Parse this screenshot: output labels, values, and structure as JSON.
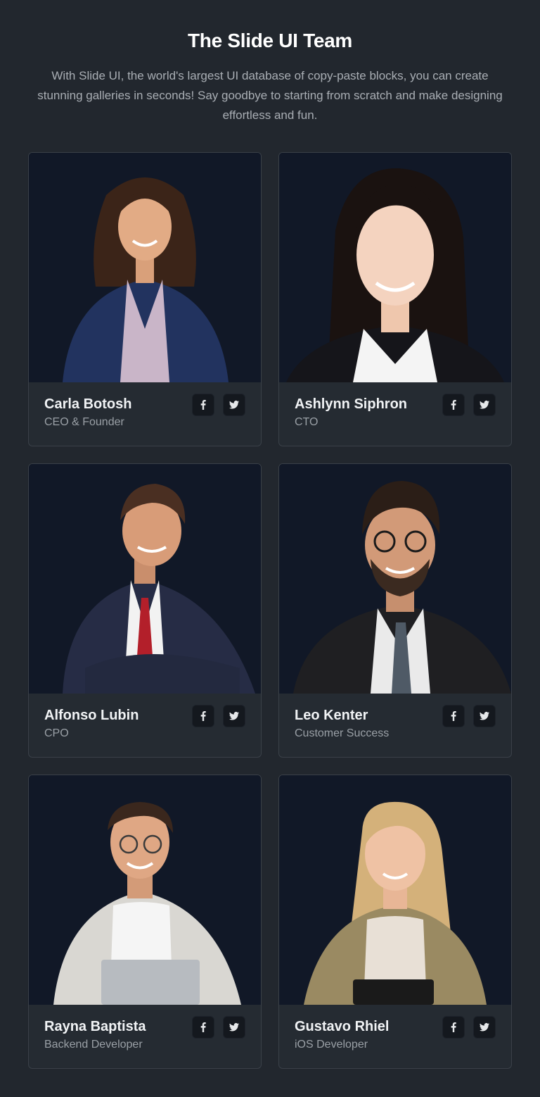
{
  "header": {
    "title": "The Slide UI Team",
    "description": "With Slide UI, the world's largest UI database of copy-paste blocks, you can create stunning galleries in seconds! Say goodbye to starting from scratch and make designing effortless and fun."
  },
  "colors": {
    "page_background": "#22272e",
    "photo_background": "#111827",
    "card_border": "#3a4048",
    "icon_button_background": "#14181e"
  },
  "members": [
    {
      "name": "Carla Botosh",
      "role": "CEO & Founder",
      "icons": [
        "facebook-icon",
        "twitter-icon"
      ]
    },
    {
      "name": "Ashlynn Siphron",
      "role": "CTO",
      "icons": [
        "facebook-icon",
        "twitter-icon"
      ]
    },
    {
      "name": "Alfonso Lubin",
      "role": "CPO",
      "icons": [
        "facebook-icon",
        "twitter-icon"
      ]
    },
    {
      "name": "Leo Kenter",
      "role": "Customer Success",
      "icons": [
        "facebook-icon",
        "twitter-icon"
      ]
    },
    {
      "name": "Rayna Baptista",
      "role": "Backend Developer",
      "icons": [
        "facebook-icon",
        "twitter-icon"
      ]
    },
    {
      "name": "Gustavo Rhiel",
      "role": "iOS Developer",
      "icons": [
        "facebook-icon",
        "twitter-icon"
      ]
    }
  ]
}
